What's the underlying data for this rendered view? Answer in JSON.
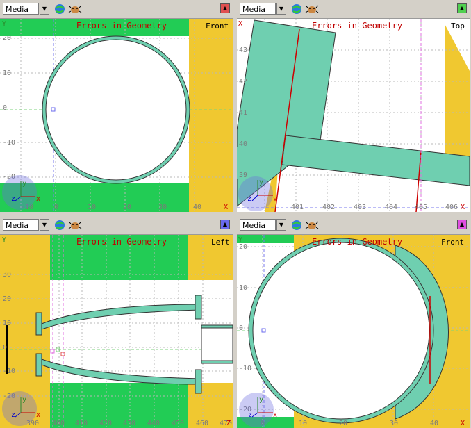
{
  "panes": [
    {
      "combo_value": "Media",
      "title": "Errors in Geometry",
      "view": "Front",
      "corner_color": "#e05050",
      "yaxis": "Y",
      "xaxis_marker": "X",
      "axis_ticks_y": [
        "20",
        "10",
        "0",
        "-10",
        "-20"
      ],
      "axis_ticks_x": [
        "-10",
        "0",
        "10",
        "20",
        "30",
        "40"
      ],
      "triad": [
        "y",
        "z",
        "x"
      ]
    },
    {
      "combo_value": "Media",
      "title": "Errors in Geometry",
      "view": "Top",
      "corner_color": "#50d050",
      "yaxis": "X",
      "xaxis_marker": "X",
      "axis_ticks_y": [
        "43",
        "42",
        "41",
        "40",
        "39"
      ],
      "axis_ticks_x": [
        "401",
        "402",
        "403",
        "404",
        "405",
        "406"
      ],
      "triad": [
        "y",
        "z",
        "x"
      ]
    },
    {
      "combo_value": "Media",
      "title": "Errors in Geometry",
      "view": "Left",
      "corner_color": "#6a6aee",
      "yaxis": "Y",
      "xaxis_marker": "Z",
      "axis_ticks_y": [
        "30",
        "20",
        "10",
        "0",
        "-10",
        "-20"
      ],
      "axis_ticks_x": [
        "390",
        "400",
        "410",
        "420",
        "430",
        "440",
        "450",
        "460",
        "470"
      ],
      "triad": [
        "y",
        "z",
        "x"
      ]
    },
    {
      "combo_value": "Media",
      "title": "Errors in Geometry",
      "view": "Front",
      "corner_color": "#e050e0",
      "yaxis": "Y",
      "xaxis_marker": "X",
      "axis_ticks_y": [
        "20",
        "10",
        "0",
        "-10",
        "-20"
      ],
      "axis_ticks_x": [
        "0",
        "10",
        "20",
        "30",
        "40"
      ],
      "triad": [
        "y",
        "z",
        "x"
      ]
    }
  ],
  "colors": {
    "yellow": "#f0c830",
    "green": "#22cc55",
    "teal": "#6fcfb0",
    "error_red": "#cc0000"
  },
  "icons": [
    "dropdown-arrow-icon",
    "globe-icon",
    "bug-icon"
  ]
}
